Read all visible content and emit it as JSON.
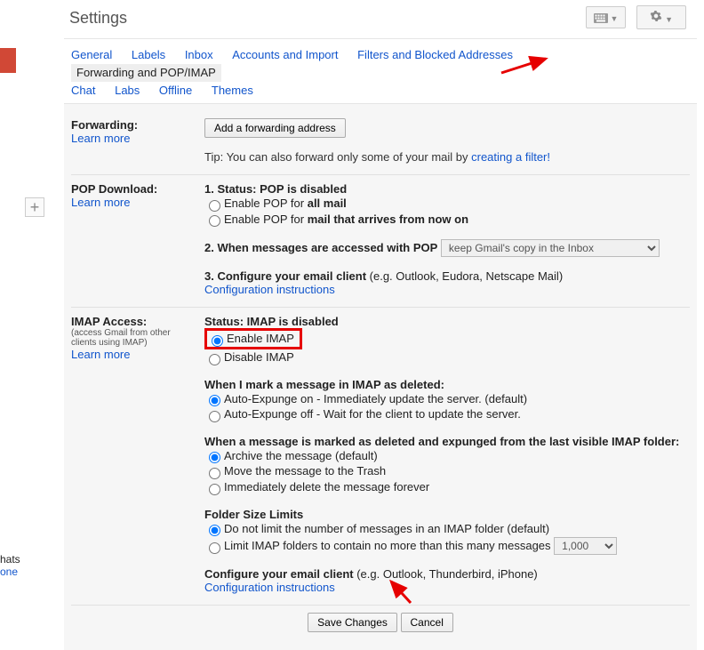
{
  "header": {
    "title": "Settings"
  },
  "tabs": {
    "general": "General",
    "labels": "Labels",
    "inbox": "Inbox",
    "accounts": "Accounts and Import",
    "filters": "Filters and Blocked Addresses",
    "forwarding": "Forwarding and POP/IMAP",
    "chat": "Chat",
    "labs": "Labs",
    "offline": "Offline",
    "themes": "Themes"
  },
  "forwarding": {
    "title": "Forwarding:",
    "learn": "Learn more",
    "add_btn": "Add a forwarding address",
    "tip_prefix": "Tip: You can also forward only some of your mail by ",
    "tip_link": "creating a filter!"
  },
  "pop": {
    "title": "POP Download:",
    "learn": "Learn more",
    "status_label": "1. Status: ",
    "status_value": "POP is disabled",
    "enable_all_prefix": "Enable POP for ",
    "enable_all_bold": "all mail",
    "enable_now_prefix": "Enable POP for ",
    "enable_now_bold": "mail that arrives from now on",
    "when_accessed": "2. When messages are accessed with POP",
    "dropdown": "keep Gmail's copy in the Inbox",
    "configure_label": "3. Configure your email client ",
    "configure_eg": "(e.g. Outlook, Eudora, Netscape Mail)",
    "config_link": "Configuration instructions"
  },
  "imap": {
    "title": "IMAP Access:",
    "subnote": "(access Gmail from other clients using IMAP)",
    "learn": "Learn more",
    "status_label": "Status: ",
    "status_value": "IMAP is disabled",
    "enable": "Enable IMAP",
    "disable": "Disable IMAP",
    "deleted_title": "When I mark a message in IMAP as deleted:",
    "expunge_on": "Auto-Expunge on - Immediately update the server. (default)",
    "expunge_off": "Auto-Expunge off - Wait for the client to update the server.",
    "expunged_title": "When a message is marked as deleted and expunged from the last visible IMAP folder:",
    "archive": "Archive the message (default)",
    "trash": "Move the message to the Trash",
    "imm_delete": "Immediately delete the message forever",
    "folder_title": "Folder Size Limits",
    "no_limit": "Do not limit the number of messages in an IMAP folder (default)",
    "limit_prefix": "Limit IMAP folders to contain no more than this many messages",
    "limit_value": "1,000",
    "configure_label": "Configure your email client ",
    "configure_eg": "(e.g. Outlook, Thunderbird, iPhone)",
    "config_link": "Configuration instructions"
  },
  "buttons": {
    "save": "Save Changes",
    "cancel": "Cancel"
  },
  "left": {
    "hats": "hats",
    "one": "one"
  }
}
